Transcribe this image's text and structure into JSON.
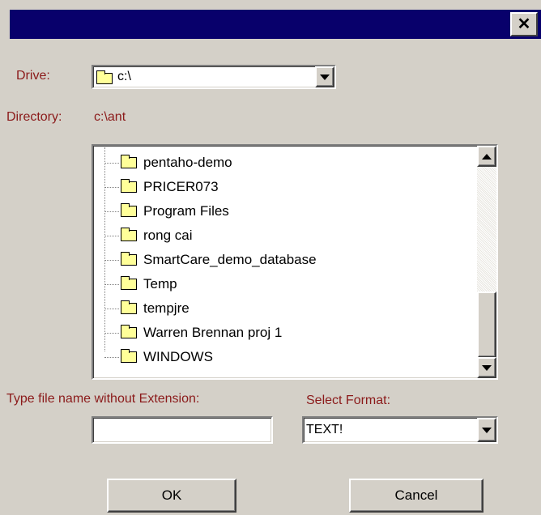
{
  "window": {
    "close_glyph": "✕"
  },
  "drive": {
    "label": "Drive:",
    "value": "c:\\"
  },
  "directory": {
    "label": "Directory:",
    "path": "c:\\ant",
    "items": [
      {
        "label": "pentaho-demo"
      },
      {
        "label": "PRICER073"
      },
      {
        "label": "Program Files"
      },
      {
        "label": "rong cai"
      },
      {
        "label": "SmartCare_demo_database"
      },
      {
        "label": "Temp"
      },
      {
        "label": "tempjre"
      },
      {
        "label": "Warren Brennan proj 1"
      },
      {
        "label": "WINDOWS"
      }
    ]
  },
  "filename": {
    "label": "Type file name without Extension:",
    "value": ""
  },
  "format": {
    "label": "Select Format:",
    "value": "TEXT!"
  },
  "buttons": {
    "ok": "OK",
    "cancel": "Cancel"
  },
  "colors": {
    "titlebar": "#08006b",
    "label": "#8b1a1a",
    "dialog": "#d4d0c8",
    "folder": "#ffff99"
  }
}
